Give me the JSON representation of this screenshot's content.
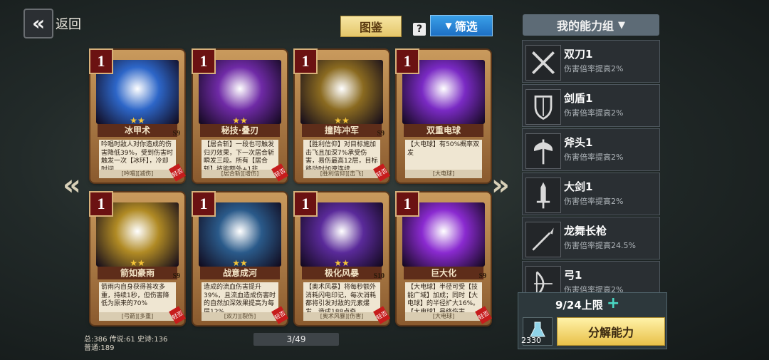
{
  "header": {
    "back_label": "返回",
    "atlas_tab": "图鉴",
    "help_glyph": "?",
    "filter_label": "筛选",
    "deck_title": "我的能力组"
  },
  "cards": [
    {
      "cost": "1",
      "name": "冰甲术",
      "id": "S9",
      "desc": "吟唱时敌人对你造成的伤害降低39%，受到伤害时触发一次【冰环】，冷却时间",
      "tags": "[吟唱][减伤]",
      "rare": "轻否",
      "stars": "★★",
      "color": "#2d66c8"
    },
    {
      "cost": "1",
      "name": "秘技·叠刃",
      "id": "",
      "desc": "【居合斩】一段也可触发归刃效果，下一次居合斩瞬发三段。所有【居合斩】技能额外+1非",
      "tags": "[居合斩][增伤]",
      "rare": "轻否",
      "stars": "★★",
      "color": "#6f2aa6"
    },
    {
      "cost": "1",
      "name": "撞阵冲军",
      "id": "S9",
      "desc": "【胜利信仰】对目标施加击飞且加深7%承受伤害，易伤最高12层，目标移动时加速连续",
      "tags": "[胜利信仰][击飞]",
      "rare": "轻否",
      "stars": "★★",
      "color": "#8a6a20"
    },
    {
      "cost": "1",
      "name": "双重电球",
      "id": "",
      "desc": "【大电球】有50%概率双发",
      "tags": "[大电球]",
      "rare": "",
      "stars": "",
      "color": "#7a2ac4"
    },
    {
      "cost": "1",
      "name": "箭如豪雨",
      "id": "S9",
      "desc": "箭雨内自身获得普攻多重，持续1秒，但伤害降低为原来的70%",
      "tags": "[弓箭][多重]",
      "rare": "轻否",
      "stars": "★★",
      "color": "#b08a24"
    },
    {
      "cost": "1",
      "name": "战意成河",
      "id": "",
      "desc": "造成的流血伤害提升39%，且流血造成伤害时的自然加深效果提高为每层12%",
      "tags": "[双刀][裂伤]",
      "rare": "轻否",
      "stars": "★★",
      "color": "#2a5a8a"
    },
    {
      "cost": "1",
      "name": "极化风暴",
      "id": "S10",
      "desc": "【奥术风暴】将每秒额外消耗闪电印记，每次消耗都将引发对敌的元素爆发，造成188点奇",
      "tags": "[奥术风暴][伤害]",
      "rare": "轻否",
      "stars": "★★",
      "color": "#5a2a9a"
    },
    {
      "cost": "1",
      "name": "巨大化",
      "id": "S9",
      "desc": "【大电球】半径可受【技能广域】加成；同时【大电球】的半径扩大16%。【大电球】最终伤害",
      "tags": "[大电球]",
      "rare": "轻否",
      "stars": "",
      "color": "#8a2ad0"
    }
  ],
  "totals": {
    "line1": "总:386 传说:61 史诗:136",
    "line2": "普通:189"
  },
  "pager": "3/49",
  "deck": [
    {
      "title": "双刀1",
      "sub": "伤害倍率提高2%",
      "icon": "dual-blades-icon"
    },
    {
      "title": "剑盾1",
      "sub": "伤害倍率提高2%",
      "icon": "sword-shield-icon"
    },
    {
      "title": "斧头1",
      "sub": "伤害倍率提高2%",
      "icon": "axe-icon"
    },
    {
      "title": "大剑1",
      "sub": "伤害倍率提高2%",
      "icon": "greatsword-icon"
    },
    {
      "title": "龙舞长枪",
      "sub": "伤害倍率提高24.5%",
      "icon": "spear-icon"
    },
    {
      "title": "弓1",
      "sub": "伤害倍率提高2%",
      "icon": "bow-icon"
    }
  ],
  "limit": {
    "text": "9/24上限",
    "flask_count": "2330",
    "decompose_label": "分解能力"
  }
}
